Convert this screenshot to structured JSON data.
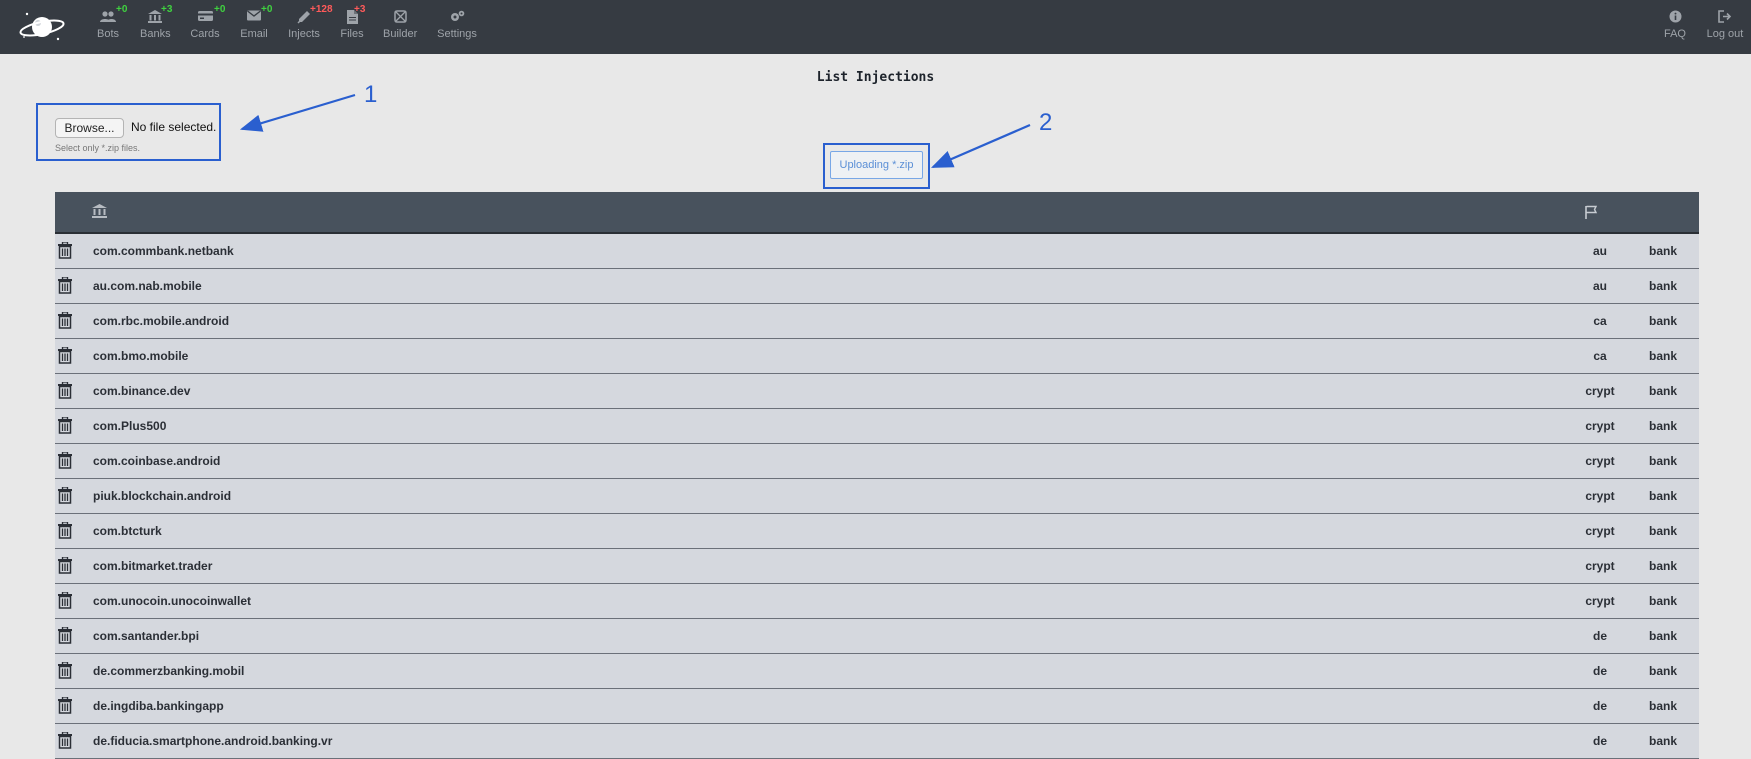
{
  "nav": {
    "items": [
      {
        "key": "bots",
        "label": "Bots",
        "badge": "+0",
        "badge_color": "green"
      },
      {
        "key": "banks",
        "label": "Banks",
        "badge": "+3",
        "badge_color": "green"
      },
      {
        "key": "cards",
        "label": "Cards",
        "badge": "+0",
        "badge_color": "green"
      },
      {
        "key": "email",
        "label": "Email",
        "badge": "+0",
        "badge_color": "green"
      },
      {
        "key": "injects",
        "label": "Injects",
        "badge": "+128",
        "badge_color": "red"
      },
      {
        "key": "files",
        "label": "Files",
        "badge": "+3",
        "badge_color": "red"
      },
      {
        "key": "builder",
        "label": "Builder",
        "badge": "",
        "badge_color": ""
      },
      {
        "key": "settings",
        "label": "Settings",
        "badge": "",
        "badge_color": ""
      }
    ],
    "right": [
      {
        "key": "faq",
        "label": "FAQ"
      },
      {
        "key": "logout",
        "label": "Log out"
      }
    ]
  },
  "page": {
    "title": "List Injections"
  },
  "upload": {
    "browse_label": "Browse...",
    "file_status": "No file selected.",
    "hint": "Select only *.zip files.",
    "upload_label": "Uploading *.zip"
  },
  "annotations": {
    "one": "1",
    "two": "2",
    "color": "#2a5fcf"
  },
  "table": {
    "rows": [
      {
        "package": "com.commbank.netbank",
        "country": "au",
        "type": "bank"
      },
      {
        "package": "au.com.nab.mobile",
        "country": "au",
        "type": "bank"
      },
      {
        "package": "com.rbc.mobile.android",
        "country": "ca",
        "type": "bank"
      },
      {
        "package": "com.bmo.mobile",
        "country": "ca",
        "type": "bank"
      },
      {
        "package": "com.binance.dev",
        "country": "crypt",
        "type": "bank"
      },
      {
        "package": "com.Plus500",
        "country": "crypt",
        "type": "bank"
      },
      {
        "package": "com.coinbase.android",
        "country": "crypt",
        "type": "bank"
      },
      {
        "package": "piuk.blockchain.android",
        "country": "crypt",
        "type": "bank"
      },
      {
        "package": "com.btcturk",
        "country": "crypt",
        "type": "bank"
      },
      {
        "package": "com.bitmarket.trader",
        "country": "crypt",
        "type": "bank"
      },
      {
        "package": "com.unocoin.unocoinwallet",
        "country": "crypt",
        "type": "bank"
      },
      {
        "package": "com.santander.bpi",
        "country": "de",
        "type": "bank"
      },
      {
        "package": "de.commerzbanking.mobil",
        "country": "de",
        "type": "bank"
      },
      {
        "package": "de.ingdiba.bankingapp",
        "country": "de",
        "type": "bank"
      },
      {
        "package": "de.fiducia.smartphone.android.banking.vr",
        "country": "de",
        "type": "bank"
      }
    ]
  },
  "colors": {
    "navbar": "#363b42",
    "table_header": "#48525d",
    "row": "#d5d8de",
    "accent": "#2a5fcf"
  }
}
